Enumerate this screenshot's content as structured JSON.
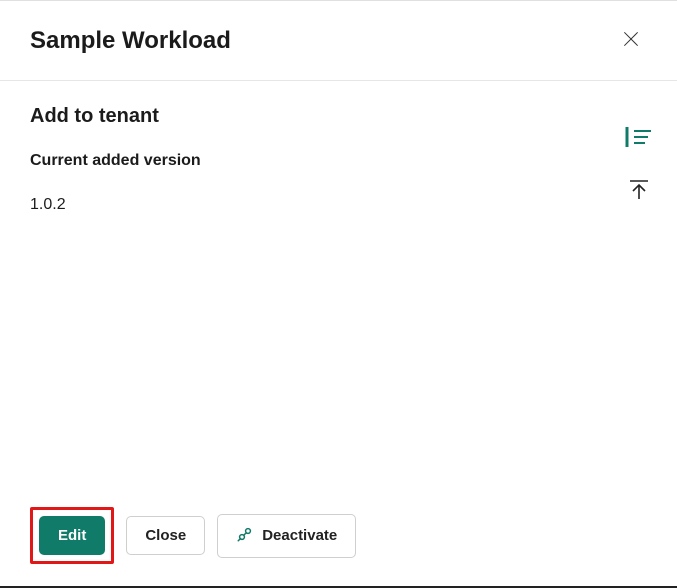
{
  "header": {
    "title": "Sample Workload"
  },
  "main": {
    "section_title": "Add to tenant",
    "version_label": "Current added version",
    "version_value": "1.0.2"
  },
  "sideActions": {
    "list_icon": "list-icon",
    "top_icon": "scroll-top-icon"
  },
  "footer": {
    "edit_label": "Edit",
    "close_label": "Close",
    "deactivate_label": "Deactivate"
  },
  "colors": {
    "primary": "#0f7b68",
    "highlight": "#e01818"
  }
}
